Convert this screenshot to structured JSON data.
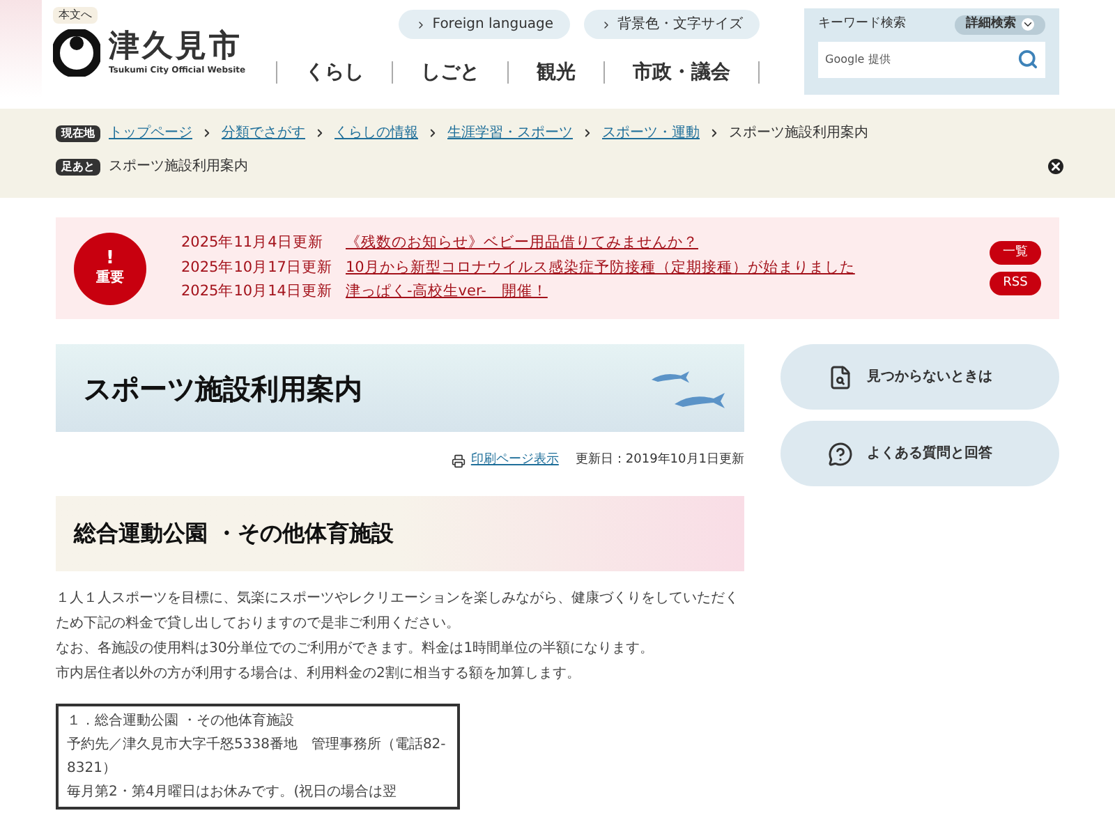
{
  "header": {
    "skip_link": "本文へ",
    "logo_title": "津久見市",
    "logo_subtitle": "Tsukumi City Official Website",
    "pills": [
      "Foreign language",
      "背景色・文字サイズ"
    ],
    "nav": [
      "くらし",
      "しごと",
      "観光",
      "市政・議会"
    ],
    "search": {
      "label": "キーワード検索",
      "advanced": "詳細検索",
      "placeholder": "Google 提供"
    }
  },
  "breadcrumb": {
    "label": "現在地",
    "links": [
      "トップページ",
      "分類でさがす",
      "くらしの情報",
      "生涯学習・スポーツ",
      "スポーツ・運動"
    ],
    "current": "スポーツ施設利用案内"
  },
  "footprints": {
    "label": "足あと",
    "items": [
      "スポーツ施設利用案内"
    ]
  },
  "notices": {
    "badge_mark": "!",
    "badge": "重要",
    "items": [
      {
        "date": "2025年11月4日更新",
        "title": "《残数のお知らせ》ベビー用品借りてみませんか？"
      },
      {
        "date": "2025年10月17日更新",
        "title": "10月から新型コロナウイルス感染症予防接種（定期接種）が始まりました"
      },
      {
        "date": "2025年10月14日更新",
        "title": "津っぱく-高校生ver-　開催！"
      }
    ],
    "buttons": [
      "一覧",
      "RSS"
    ]
  },
  "page_title": "スポーツ施設利用案内",
  "print_link": "印刷ページ表示",
  "updated": "更新日：2019年10月1日更新",
  "side_buttons": [
    {
      "kind": "search",
      "label": "見つからないときは"
    },
    {
      "kind": "faq",
      "label": "よくある質問と回答"
    }
  ],
  "section_heading": "総合運動公園 ・その他体育施設",
  "paragraphs": [
    "１人１人スポーツを目標に、気楽にスポーツやレクリエーションを楽しみながら、健康づくりをしていただくため下記の料金で貸し出しておりますので是非ご利用ください。",
    "なお、各施設の使用料は30分単位でのご利用ができます。料金は1時間単位の半額になります。",
    "市内居住者以外の方が利用する場合は、利用料金の2割に相当する額を加算します。"
  ],
  "info_box": [
    "１．総合運動公園 ・その他体育施設",
    "予約先／津久見市大字千怒5338番地　管理事務所（電話82-8321）",
    "毎月第2・第4月曜日はお休みです。(祝日の場合は翌"
  ]
}
